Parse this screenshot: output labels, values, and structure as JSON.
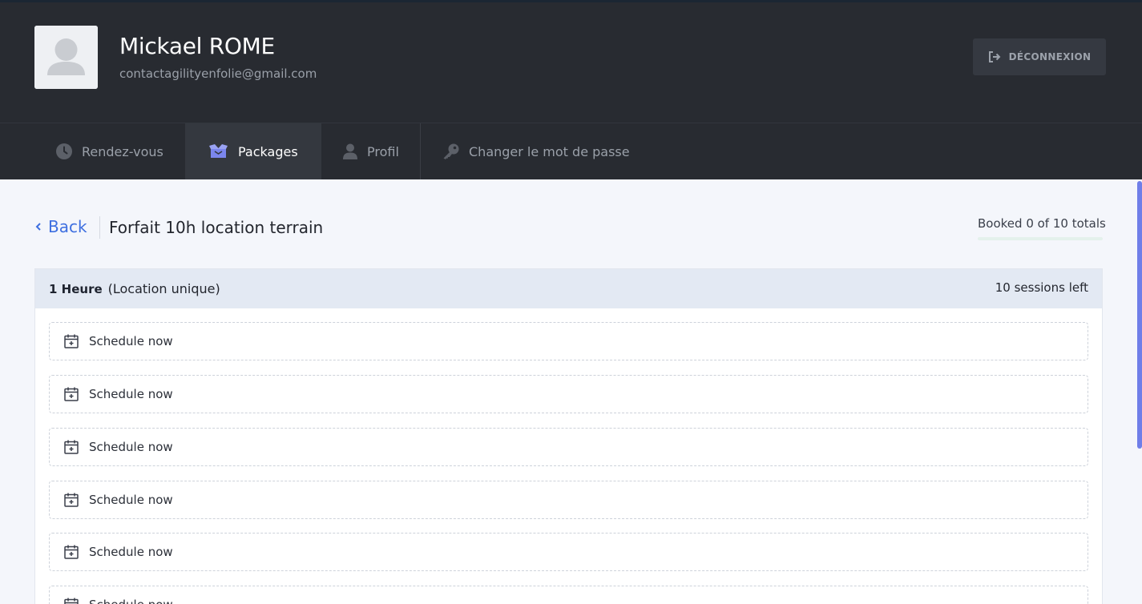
{
  "user": {
    "name": "Mickael ROME",
    "email": "contactagilityenfolie@gmail.com"
  },
  "header": {
    "logout_label": "DÉCONNEXION",
    "logout_icon": "sign-out-icon"
  },
  "nav": {
    "items": [
      {
        "label": "Rendez-vous",
        "icon": "clock-icon",
        "active": false
      },
      {
        "label": "Packages",
        "icon": "box-icon",
        "active": true
      },
      {
        "label": "Profil",
        "icon": "user-icon",
        "active": false
      },
      {
        "label": "Changer le mot de passe",
        "icon": "key-icon",
        "active": false
      }
    ]
  },
  "package": {
    "back_label": "Back",
    "title": "Forfait 10h location terrain",
    "booked_text": "Booked 0 of 10 totals",
    "booked_progress": 0
  },
  "service": {
    "name": "1 Heure",
    "type": "(Location unique)",
    "sessions_left": "10 sessions left"
  },
  "slots": [
    {
      "label": "Schedule now"
    },
    {
      "label": "Schedule now"
    },
    {
      "label": "Schedule now"
    },
    {
      "label": "Schedule now"
    },
    {
      "label": "Schedule now"
    },
    {
      "label": "Schedule now"
    }
  ],
  "colors": {
    "accent": "#3e6fe0",
    "active_icon": "#7b86ee",
    "header_bg": "#282b31",
    "progress": "#3ec28f"
  }
}
